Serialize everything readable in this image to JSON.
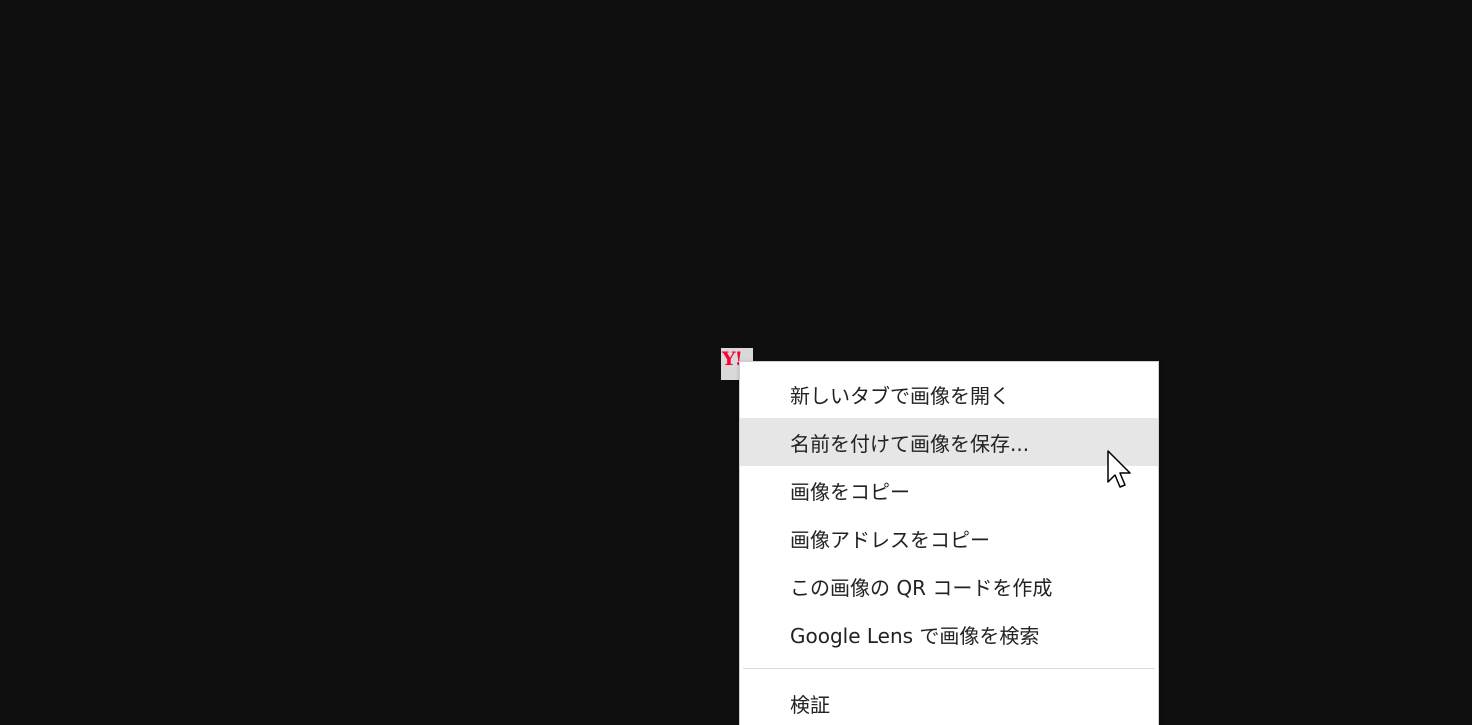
{
  "thumbnail": {
    "logo_text": "Y!"
  },
  "context_menu": {
    "items": [
      {
        "label": "新しいタブで画像を開く",
        "highlighted": false
      },
      {
        "label": "名前を付けて画像を保存...",
        "highlighted": true
      },
      {
        "label": "画像をコピー",
        "highlighted": false
      },
      {
        "label": "画像アドレスをコピー",
        "highlighted": false
      },
      {
        "label": "この画像の QR コードを作成",
        "highlighted": false
      },
      {
        "label": "Google Lens で画像を検索",
        "highlighted": false
      }
    ],
    "footer_items": [
      {
        "label": "検証"
      }
    ]
  },
  "colors": {
    "page_background": "#0f0f0f",
    "menu_background": "#ffffff",
    "highlight": "#e6e6e6",
    "logo_red": "#ff0033"
  },
  "icons": {
    "cursor": "arrow-cursor-icon"
  }
}
